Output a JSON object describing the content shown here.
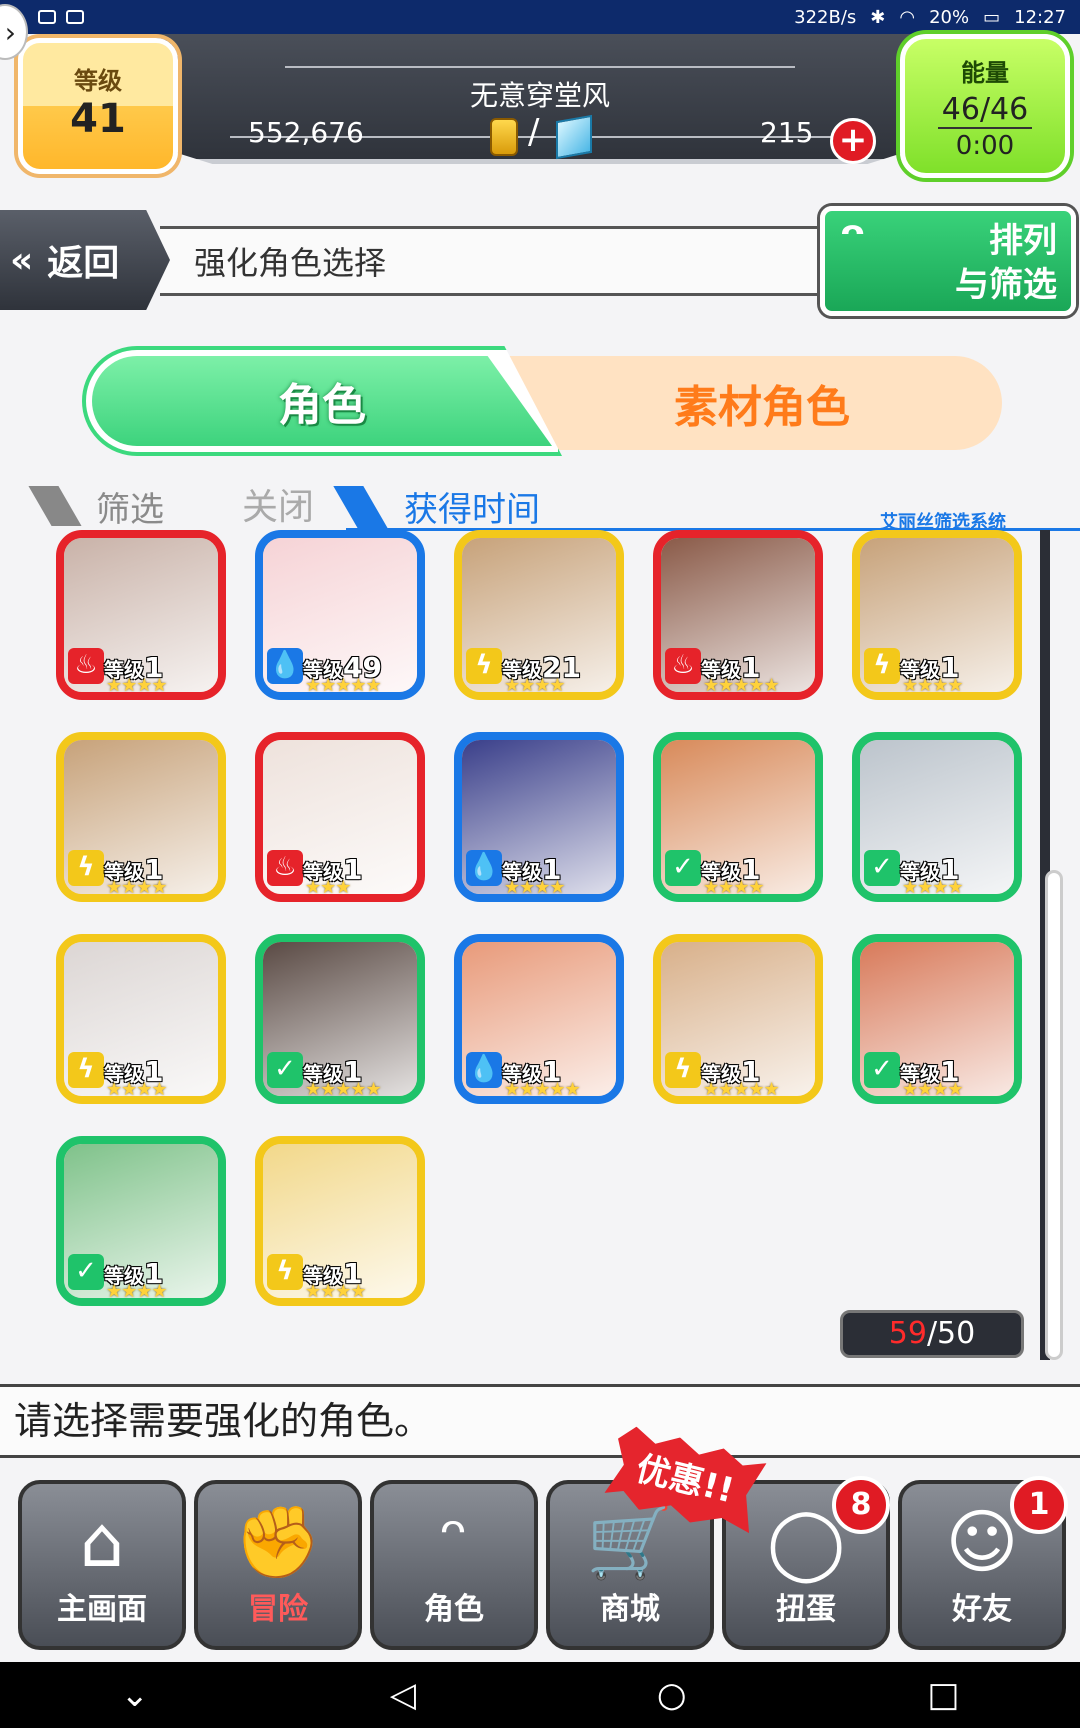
{
  "status_bar": {
    "speed": "322B/s",
    "battery": "20%",
    "time": "12:27"
  },
  "header": {
    "level_label": "等级",
    "level_value": "41",
    "player_name": "无意穿堂风",
    "gold": "552,676",
    "gems": "215",
    "energy_label": "能量",
    "energy_value": "46/46",
    "energy_timer": "0:00"
  },
  "nav": {
    "back_label": "返回",
    "page_title": "强化角色选择",
    "sort_label_line1": "排列",
    "sort_label_line2": "与筛选"
  },
  "tabs": {
    "character": "角色",
    "material": "素材角色"
  },
  "filter": {
    "filter_label": "筛选",
    "filter_state": "关闭",
    "sort_label": "获得时间",
    "system_label": "艾丽丝筛选系统"
  },
  "colors": {
    "fire": "#e6232a",
    "water": "#1a78e6",
    "thunder": "#f3c81a",
    "wind": "#1fc36a"
  },
  "cards": [
    {
      "element": "fire",
      "elem_icon": "flame-icon",
      "level_label": "等级",
      "level": "1",
      "stars": "★★★★",
      "portrait": "#c9b2a8"
    },
    {
      "element": "water",
      "elem_icon": "water-drop-icon",
      "level_label": "等级",
      "level": "49",
      "stars": "★★★★★",
      "portrait": "#f6d3d6"
    },
    {
      "element": "thunder",
      "elem_icon": "lightning-icon",
      "level_label": "等级",
      "level": "21",
      "stars": "★★★★",
      "portrait": "#c7a27a"
    },
    {
      "element": "fire",
      "elem_icon": "flame-icon",
      "level_label": "等级",
      "level": "1",
      "stars": "★★★★★",
      "portrait": "#8a5a48"
    },
    {
      "element": "thunder",
      "elem_icon": "lightning-icon",
      "level_label": "等级",
      "level": "1",
      "stars": "★★★★",
      "portrait": "#c7a27a"
    },
    {
      "element": "thunder",
      "elem_icon": "lightning-icon",
      "level_label": "等级",
      "level": "1",
      "stars": "★★★★",
      "portrait": "#c7a27a"
    },
    {
      "element": "fire",
      "elem_icon": "flame-icon",
      "level_label": "等级",
      "level": "1",
      "stars": "★★★",
      "portrait": "#eee2dc"
    },
    {
      "element": "water",
      "elem_icon": "water-drop-icon",
      "level_label": "等级",
      "level": "1",
      "stars": "★★★★",
      "portrait": "#3a3f8a"
    },
    {
      "element": "wind",
      "elem_icon": "leaf-icon",
      "level_label": "等级",
      "level": "1",
      "stars": "★★★★",
      "portrait": "#d88a5a"
    },
    {
      "element": "wind",
      "elem_icon": "leaf-icon",
      "level_label": "等级",
      "level": "1",
      "stars": "★★★★",
      "portrait": "#bcc4cc"
    },
    {
      "element": "thunder",
      "elem_icon": "lightning-icon",
      "level_label": "等级",
      "level": "1",
      "stars": "★★★★",
      "portrait": "#dcd6d4"
    },
    {
      "element": "wind",
      "elem_icon": "leaf-icon",
      "level_label": "等级",
      "level": "1",
      "stars": "★★★★★",
      "portrait": "#5a4a44"
    },
    {
      "element": "water",
      "elem_icon": "water-drop-icon",
      "level_label": "等级",
      "level": "1",
      "stars": "★★★★★",
      "portrait": "#e89a7a"
    },
    {
      "element": "thunder",
      "elem_icon": "lightning-icon",
      "level_label": "等级",
      "level": "1",
      "stars": "★★★★★",
      "portrait": "#d8b08a"
    },
    {
      "element": "wind",
      "elem_icon": "leaf-icon",
      "level_label": "等级",
      "level": "1",
      "stars": "★★★★",
      "portrait": "#d87a5a"
    },
    {
      "element": "wind",
      "elem_icon": "leaf-icon",
      "level_label": "等级",
      "level": "1",
      "stars": "★★★★",
      "portrait": "#7fc28a"
    },
    {
      "element": "thunder",
      "elem_icon": "lightning-icon",
      "level_label": "等级",
      "level": "1",
      "stars": "★★★★",
      "portrait": "#f2d88a"
    }
  ],
  "count": {
    "current": "59",
    "sep": "/",
    "max": "50"
  },
  "message": "请选择需要强化的角色。",
  "bottom_nav": [
    {
      "label": "主画面",
      "icon": "home-icon",
      "glyph": "⌂"
    },
    {
      "label": "冒险",
      "icon": "handshake-icon",
      "glyph": "✊"
    },
    {
      "label": "角色",
      "icon": "rabbit-icon",
      "glyph": "ᵔ"
    },
    {
      "label": "商城",
      "icon": "cart-icon",
      "glyph": "🛒"
    },
    {
      "label": "扭蛋",
      "icon": "egg-icon",
      "glyph": "◯"
    },
    {
      "label": "好友",
      "icon": "friends-icon",
      "glyph": "☺"
    }
  ],
  "badges": {
    "gacha": "8",
    "friends": "1"
  },
  "promo": "优惠!!"
}
